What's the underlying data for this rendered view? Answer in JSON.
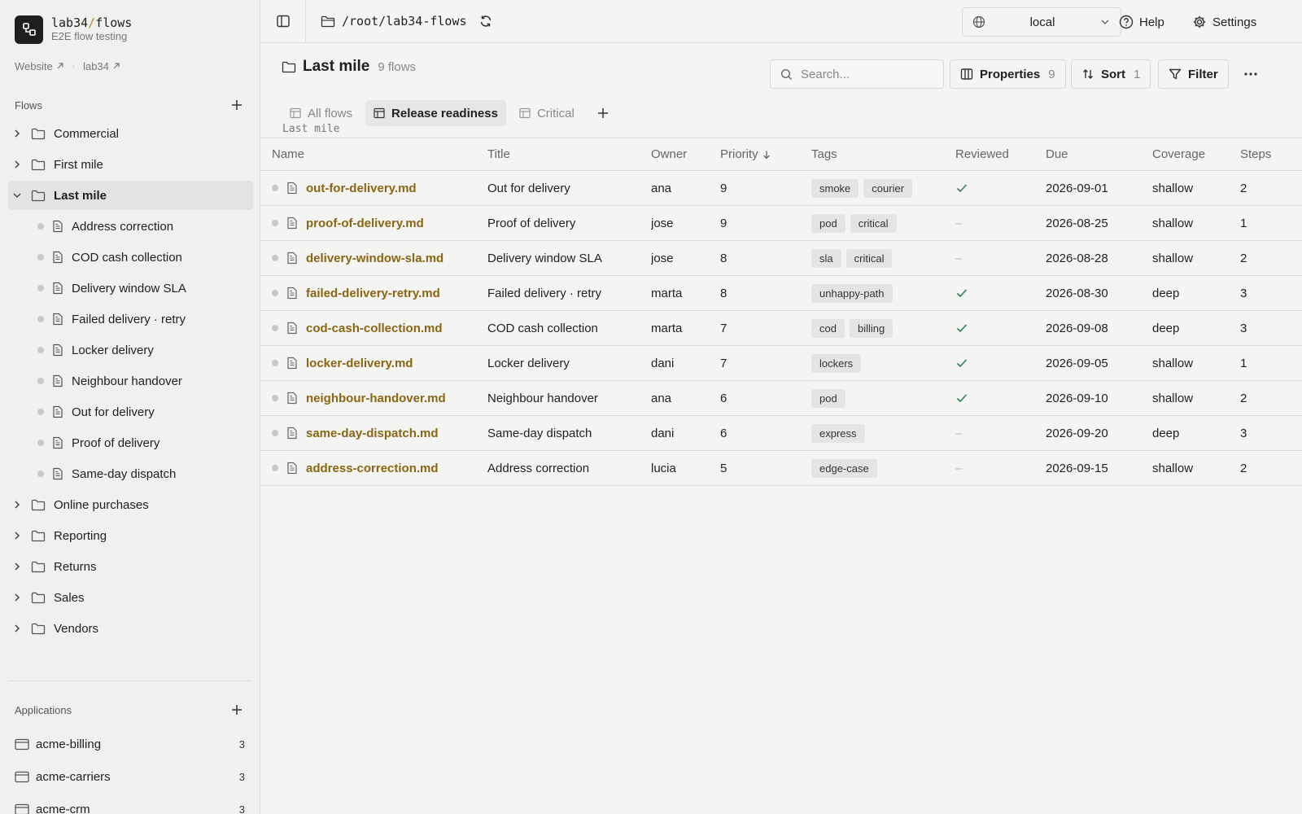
{
  "brand": {
    "name": "lab34",
    "slash": "/",
    "product": "flows",
    "subtitle": "E2E flow testing"
  },
  "ext_links": [
    {
      "label": "Website"
    },
    {
      "label": "lab34"
    }
  ],
  "ext_sep": "·",
  "sidebar": {
    "flows_heading": "Flows",
    "folders_top": [
      "Commercial",
      "First mile"
    ],
    "active_folder": "Last mile",
    "files": [
      "Address correction",
      "COD cash collection",
      "Delivery window SLA",
      "Failed delivery · retry",
      "Locker delivery",
      "Neighbour handover",
      "Out for delivery",
      "Proof of delivery",
      "Same-day dispatch"
    ],
    "folders_bottom": [
      "Online purchases",
      "Reporting",
      "Returns",
      "Sales",
      "Vendors"
    ],
    "apps_heading": "Applications",
    "apps": [
      {
        "name": "acme-billing",
        "count": "3"
      },
      {
        "name": "acme-carriers",
        "count": "3"
      },
      {
        "name": "acme-crm",
        "count": "3"
      }
    ]
  },
  "topbar": {
    "path": "/root/lab34-flows",
    "env_value": "local",
    "help_label": "Help",
    "settings_label": "Settings"
  },
  "view": {
    "title": "Last mile",
    "count": "9 flows",
    "subtitle": "Last mile",
    "search_placeholder": "Search...",
    "properties_label": "Properties",
    "properties_count": "9",
    "sort_label": "Sort",
    "sort_count": "1",
    "filter_label": "Filter",
    "tabs": [
      {
        "label": "All flows",
        "active": false
      },
      {
        "label": "Release readiness",
        "active": true
      },
      {
        "label": "Critical",
        "active": false
      }
    ]
  },
  "table": {
    "columns": [
      "Name",
      "Title",
      "Owner",
      "Priority",
      "Tags",
      "Reviewed",
      "Due",
      "Coverage",
      "Steps"
    ],
    "rows": [
      {
        "name": "out-for-delivery.md",
        "title": "Out for delivery",
        "owner": "ana",
        "priority": "9",
        "tags": [
          "smoke",
          "courier"
        ],
        "reviewed": true,
        "due": "2026-09-01",
        "coverage": "shallow",
        "steps": "2"
      },
      {
        "name": "proof-of-delivery.md",
        "title": "Proof of delivery",
        "owner": "jose",
        "priority": "9",
        "tags": [
          "pod",
          "critical"
        ],
        "reviewed": false,
        "due": "2026-08-25",
        "coverage": "shallow",
        "steps": "1"
      },
      {
        "name": "delivery-window-sla.md",
        "title": "Delivery window SLA",
        "owner": "jose",
        "priority": "8",
        "tags": [
          "sla",
          "critical"
        ],
        "reviewed": false,
        "due": "2026-08-28",
        "coverage": "shallow",
        "steps": "2"
      },
      {
        "name": "failed-delivery-retry.md",
        "title": "Failed delivery · retry",
        "owner": "marta",
        "priority": "8",
        "tags": [
          "unhappy-path"
        ],
        "reviewed": true,
        "due": "2026-08-30",
        "coverage": "deep",
        "steps": "3"
      },
      {
        "name": "cod-cash-collection.md",
        "title": "COD cash collection",
        "owner": "marta",
        "priority": "7",
        "tags": [
          "cod",
          "billing"
        ],
        "reviewed": true,
        "due": "2026-09-08",
        "coverage": "deep",
        "steps": "3"
      },
      {
        "name": "locker-delivery.md",
        "title": "Locker delivery",
        "owner": "dani",
        "priority": "7",
        "tags": [
          "lockers"
        ],
        "reviewed": true,
        "due": "2026-09-05",
        "coverage": "shallow",
        "steps": "1"
      },
      {
        "name": "neighbour-handover.md",
        "title": "Neighbour handover",
        "owner": "ana",
        "priority": "6",
        "tags": [
          "pod"
        ],
        "reviewed": true,
        "due": "2026-09-10",
        "coverage": "shallow",
        "steps": "2"
      },
      {
        "name": "same-day-dispatch.md",
        "title": "Same-day dispatch",
        "owner": "dani",
        "priority": "6",
        "tags": [
          "express"
        ],
        "reviewed": false,
        "due": "2026-09-20",
        "coverage": "deep",
        "steps": "3"
      },
      {
        "name": "address-correction.md",
        "title": "Address correction",
        "owner": "lucia",
        "priority": "5",
        "tags": [
          "edge-case"
        ],
        "reviewed": false,
        "due": "2026-09-15",
        "coverage": "shallow",
        "steps": "2"
      }
    ],
    "empty_marker": "–"
  },
  "colors": {
    "accent": "#8a6512",
    "brand_slash": "#b08a2e",
    "check": "#2f7d5a"
  }
}
